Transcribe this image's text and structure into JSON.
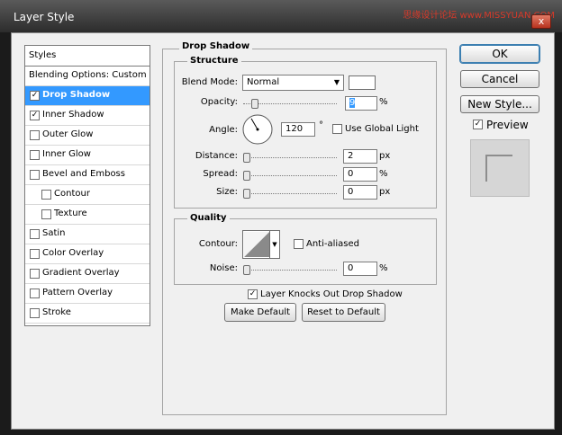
{
  "window": {
    "title": "Layer Style",
    "watermark": "思缘设计论坛 www.MISSYUAN.COM",
    "close_glyph": "x"
  },
  "styles_list": {
    "header": "Styles",
    "items": [
      {
        "label": "Blending Options: Custom",
        "checkbox": false,
        "checked": false,
        "selected": false
      },
      {
        "label": "Drop Shadow",
        "checkbox": true,
        "checked": true,
        "selected": true
      },
      {
        "label": "Inner Shadow",
        "checkbox": true,
        "checked": true,
        "selected": false
      },
      {
        "label": "Outer Glow",
        "checkbox": true,
        "checked": false,
        "selected": false
      },
      {
        "label": "Inner Glow",
        "checkbox": true,
        "checked": false,
        "selected": false
      },
      {
        "label": "Bevel and Emboss",
        "checkbox": true,
        "checked": false,
        "selected": false
      },
      {
        "label": "Contour",
        "checkbox": true,
        "checked": false,
        "selected": false,
        "indent": true
      },
      {
        "label": "Texture",
        "checkbox": true,
        "checked": false,
        "selected": false,
        "indent": true
      },
      {
        "label": "Satin",
        "checkbox": true,
        "checked": false,
        "selected": false
      },
      {
        "label": "Color Overlay",
        "checkbox": true,
        "checked": false,
        "selected": false
      },
      {
        "label": "Gradient Overlay",
        "checkbox": true,
        "checked": false,
        "selected": false
      },
      {
        "label": "Pattern Overlay",
        "checkbox": true,
        "checked": false,
        "selected": false
      },
      {
        "label": "Stroke",
        "checkbox": true,
        "checked": false,
        "selected": false
      }
    ]
  },
  "drop_shadow": {
    "title": "Drop Shadow",
    "structure": {
      "title": "Structure",
      "blend_mode_label": "Blend Mode:",
      "blend_mode_value": "Normal",
      "shadow_color": "#ffffff",
      "opacity_label": "Opacity:",
      "opacity_value": "9",
      "opacity_unit": "%",
      "angle_label": "Angle:",
      "angle_value": "120",
      "angle_unit": "°",
      "use_global_light_label": "Use Global Light",
      "use_global_light": false,
      "distance_label": "Distance:",
      "distance_value": "2",
      "distance_unit": "px",
      "spread_label": "Spread:",
      "spread_value": "0",
      "spread_unit": "%",
      "size_label": "Size:",
      "size_value": "0",
      "size_unit": "px"
    },
    "quality": {
      "title": "Quality",
      "contour_label": "Contour:",
      "anti_aliased_label": "Anti-aliased",
      "anti_aliased": false,
      "noise_label": "Noise:",
      "noise_value": "0",
      "noise_unit": "%"
    },
    "knocks_out_label": "Layer Knocks Out Drop Shadow",
    "knocks_out": true,
    "make_default_label": "Make Default",
    "reset_default_label": "Reset to Default"
  },
  "right_buttons": {
    "ok": "OK",
    "cancel": "Cancel",
    "new_style": "New Style...",
    "preview_label": "Preview",
    "preview_checked": true
  },
  "colors": {
    "selection": "#3399ff",
    "ok_border": "#3c7fb1"
  }
}
